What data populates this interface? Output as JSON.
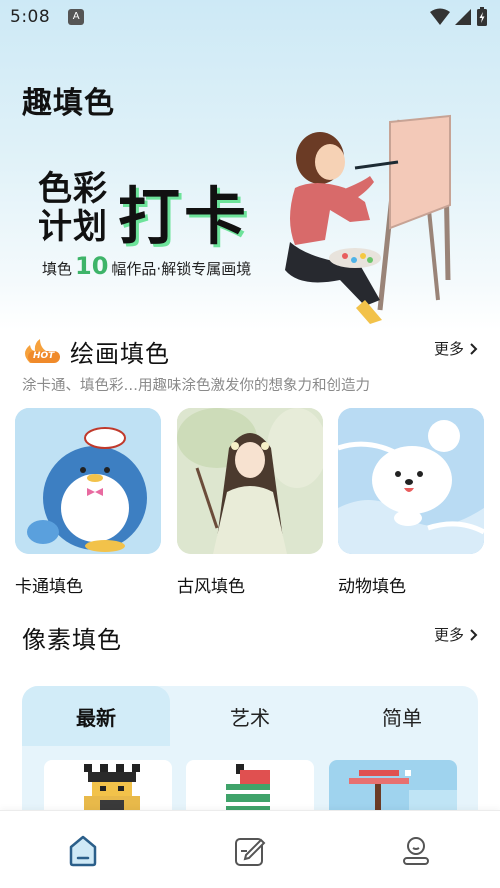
{
  "status_bar": {
    "time": "5:08",
    "notification_glyph": "A"
  },
  "app_title": "趣填色",
  "banner": {
    "line1": "色彩",
    "line2": "计划",
    "headline": "打卡",
    "subtitle_prefix": "填色",
    "subtitle_number": "10",
    "subtitle_suffix": "幅作品·解锁专属画境"
  },
  "painting_section": {
    "badge": "HOT",
    "title": "绘画填色",
    "more": "更多",
    "description": "涂卡通、填色彩…用趣味涂色激发你的想象力和创造力",
    "cards": [
      {
        "label": "卡通填色"
      },
      {
        "label": "古风填色"
      },
      {
        "label": "动物填色"
      }
    ]
  },
  "pixel_section": {
    "title": "像素填色",
    "more": "更多",
    "tabs": [
      "最新",
      "艺术",
      "简单"
    ],
    "active_tab": 0
  },
  "bottom_nav": {
    "items": [
      {
        "icon": "home-icon"
      },
      {
        "icon": "edit-icon"
      },
      {
        "icon": "profile-icon"
      }
    ]
  },
  "colors": {
    "accent_green": "#3eb469",
    "headline_shadow": "#6de39a",
    "tab_bg": "#e6f4fb"
  }
}
